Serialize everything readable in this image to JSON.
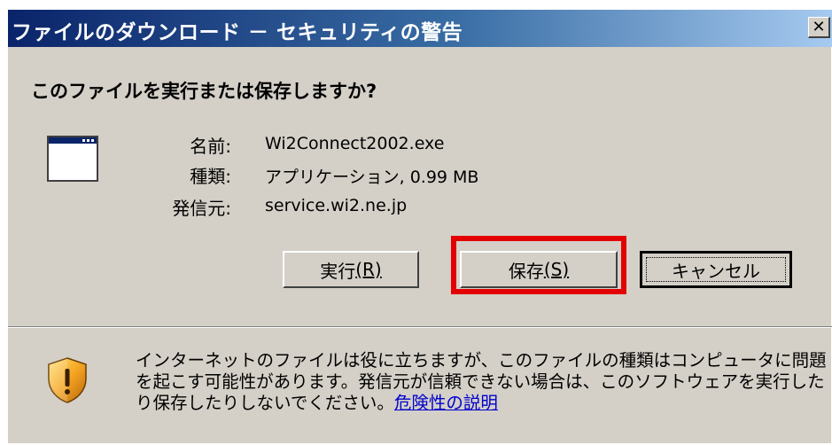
{
  "window": {
    "title": "ファイルのダウンロード － セキュリティの警告",
    "close_glyph": "✕"
  },
  "dialog": {
    "question": "このファイルを実行または保存しますか?",
    "app_icon": "application-window-icon",
    "fields": {
      "name_label": "名前:",
      "name_value": "Wi2Connect2002.exe",
      "type_label": "種類:",
      "type_value": "アプリケーション, 0.99 MB",
      "from_label": "発信元:",
      "from_value": "service.wi2.ne.jp"
    }
  },
  "buttons": {
    "run_label": "実行",
    "run_accel": "(R)",
    "save_label": "保存",
    "save_accel": "(S)",
    "cancel_label": "キャンセル"
  },
  "highlight": {
    "target": "save-button",
    "color": "#e30000"
  },
  "footer": {
    "shield_icon": "security-shield-icon",
    "warning_text": "インターネットのファイルは役に立ちますが、このファイルの種類はコンピュータに問題を起こす可能性があります。発信元が信頼できない場合は、このソフトウェアを実行したり保存したりしないでください。",
    "link_text": "危険性の説明"
  },
  "colors": {
    "dialog_bg": "#d4d0c8",
    "title_gradient_start": "#0a246a",
    "title_gradient_end": "#a6caf0",
    "link": "#0000cc"
  }
}
